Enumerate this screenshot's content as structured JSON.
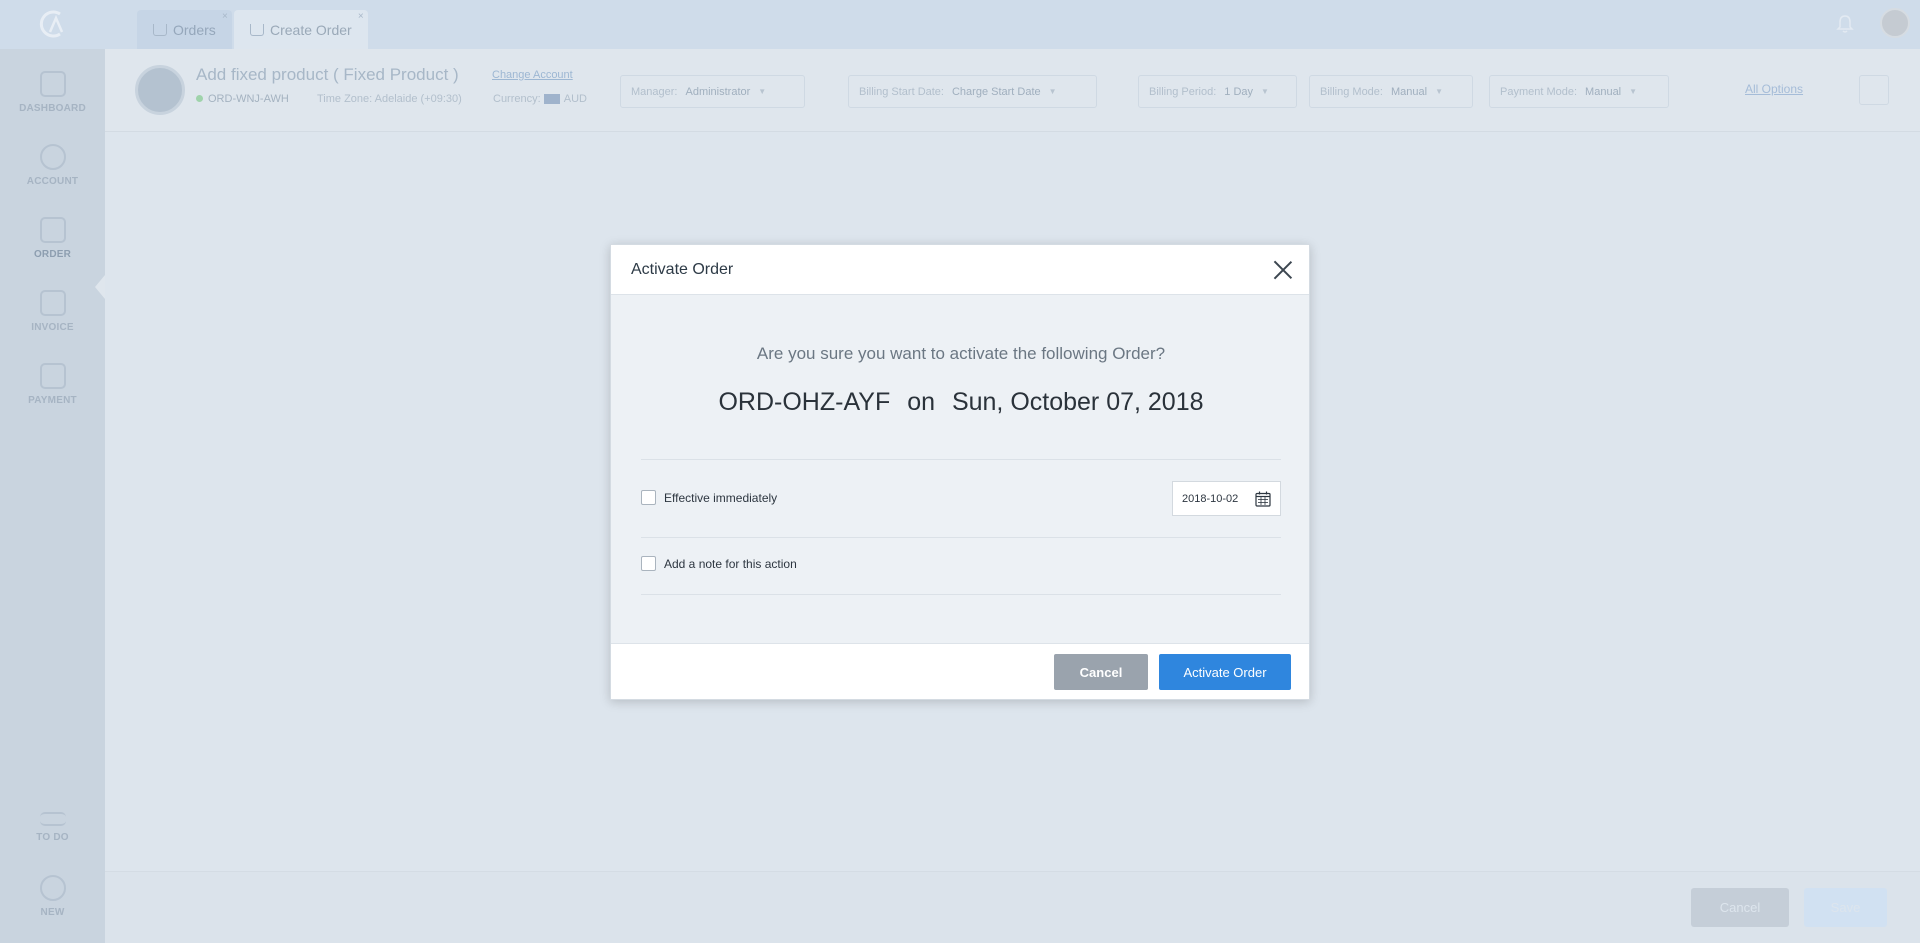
{
  "tabs": [
    {
      "label": "Orders"
    },
    {
      "label": "Create Order"
    }
  ],
  "sidebar": {
    "items": [
      {
        "label": "DASHBOARD"
      },
      {
        "label": "ACCOUNT"
      },
      {
        "label": "ORDER"
      },
      {
        "label": "INVOICE"
      },
      {
        "label": "PAYMENT"
      },
      {
        "label": "TO DO"
      },
      {
        "label": "NEW"
      }
    ]
  },
  "header": {
    "title": "Add fixed product ( Fixed Product )",
    "change_account": "Change Account",
    "order_id": "ORD-WNJ-AWH",
    "timezone": "Time Zone: Adelaide (+09:30)",
    "currency_label": "Currency:",
    "currency_value": "AUD",
    "manager_label": "Manager:",
    "manager_value": "Administrator",
    "billing_start_label": "Billing Start Date:",
    "billing_start_value": "Charge Start Date",
    "billing_period_label": "Billing Period:",
    "billing_period_value": "1 Day",
    "billing_mode_label": "Billing Mode:",
    "billing_mode_value": "Manual",
    "payment_mode_label": "Payment Mode:",
    "payment_mode_value": "Manual",
    "all_options": "All Options"
  },
  "footer": {
    "cancel_label": "Cancel",
    "save_label": "Save"
  },
  "modal": {
    "title": "Activate Order",
    "question": "Are you sure you want to activate the following Order?",
    "order_id": "ORD-OHZ-AYF",
    "on": "on",
    "date_text": "Sun, October 07, 2018",
    "effective_label": "Effective immediately",
    "date_value": "2018-10-02",
    "note_label": "Add a note for this action",
    "cancel_label": "Cancel",
    "activate_label": "Activate Order"
  }
}
